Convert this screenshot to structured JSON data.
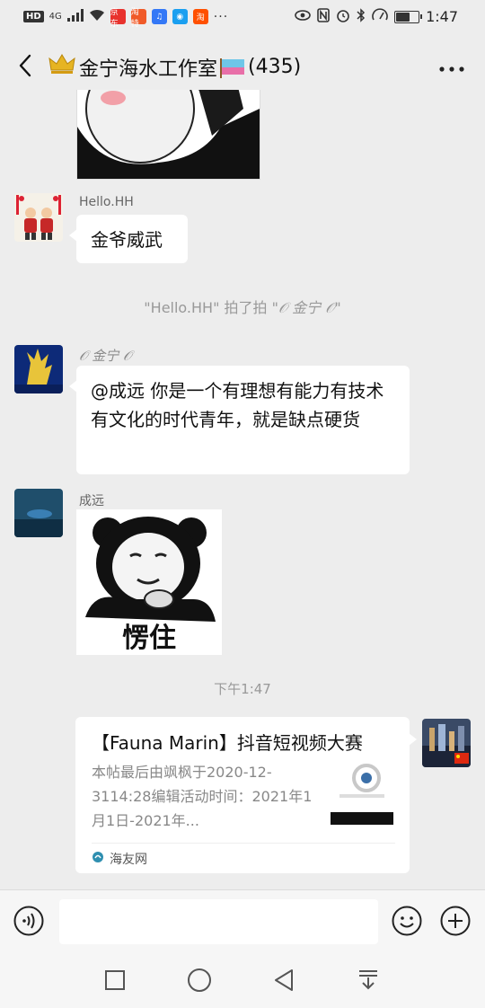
{
  "status_bar": {
    "hd": "HD",
    "network": "4G",
    "apps": [
      {
        "icon": "jd-icon",
        "text": "京东",
        "color": "#e8322d"
      },
      {
        "icon": "taobao-icon",
        "text": "淘特",
        "color": "#f05a28"
      },
      {
        "icon": "music-icon",
        "text": "♫",
        "color": "#3478f6"
      },
      {
        "icon": "qq-icon",
        "text": "◉",
        "color": "#1a9ff0"
      },
      {
        "icon": "taobao-icon",
        "text": "淘",
        "color": "#ff5000"
      }
    ],
    "more": "···",
    "time": "1:47",
    "battery_level": 0.7
  },
  "header": {
    "title": "金宁海水工作室",
    "count": "(435)"
  },
  "messages": {
    "hello_sender": "Hello.HH",
    "hello_text": "金爷威武",
    "pat_notice": {
      "before": "\"Hello.HH\" 拍了拍 \"",
      "nick": "𝒪 金宁 𝒪",
      "after": "\""
    },
    "jinning_nick": "𝒪 金宁 𝒪",
    "jinning_text": "@成远  你是一个有理想有能力有技术有文化的时代青年，就是缺点硬货",
    "chengyuan_sender": "成远",
    "meme_caption": "愣住",
    "timestamp": "下午1:47"
  },
  "card": {
    "title": "【Fauna Marin】抖音短视频大赛",
    "desc": "本帖最后由飒枫于2020-12-3114:28编辑活动时间：2021年1月1日-2021年...",
    "source": "海友网"
  },
  "input": {
    "placeholder": ""
  },
  "colors": {
    "background": "#ededed",
    "bubble": "#ffffff",
    "crown": "#d9a520"
  }
}
